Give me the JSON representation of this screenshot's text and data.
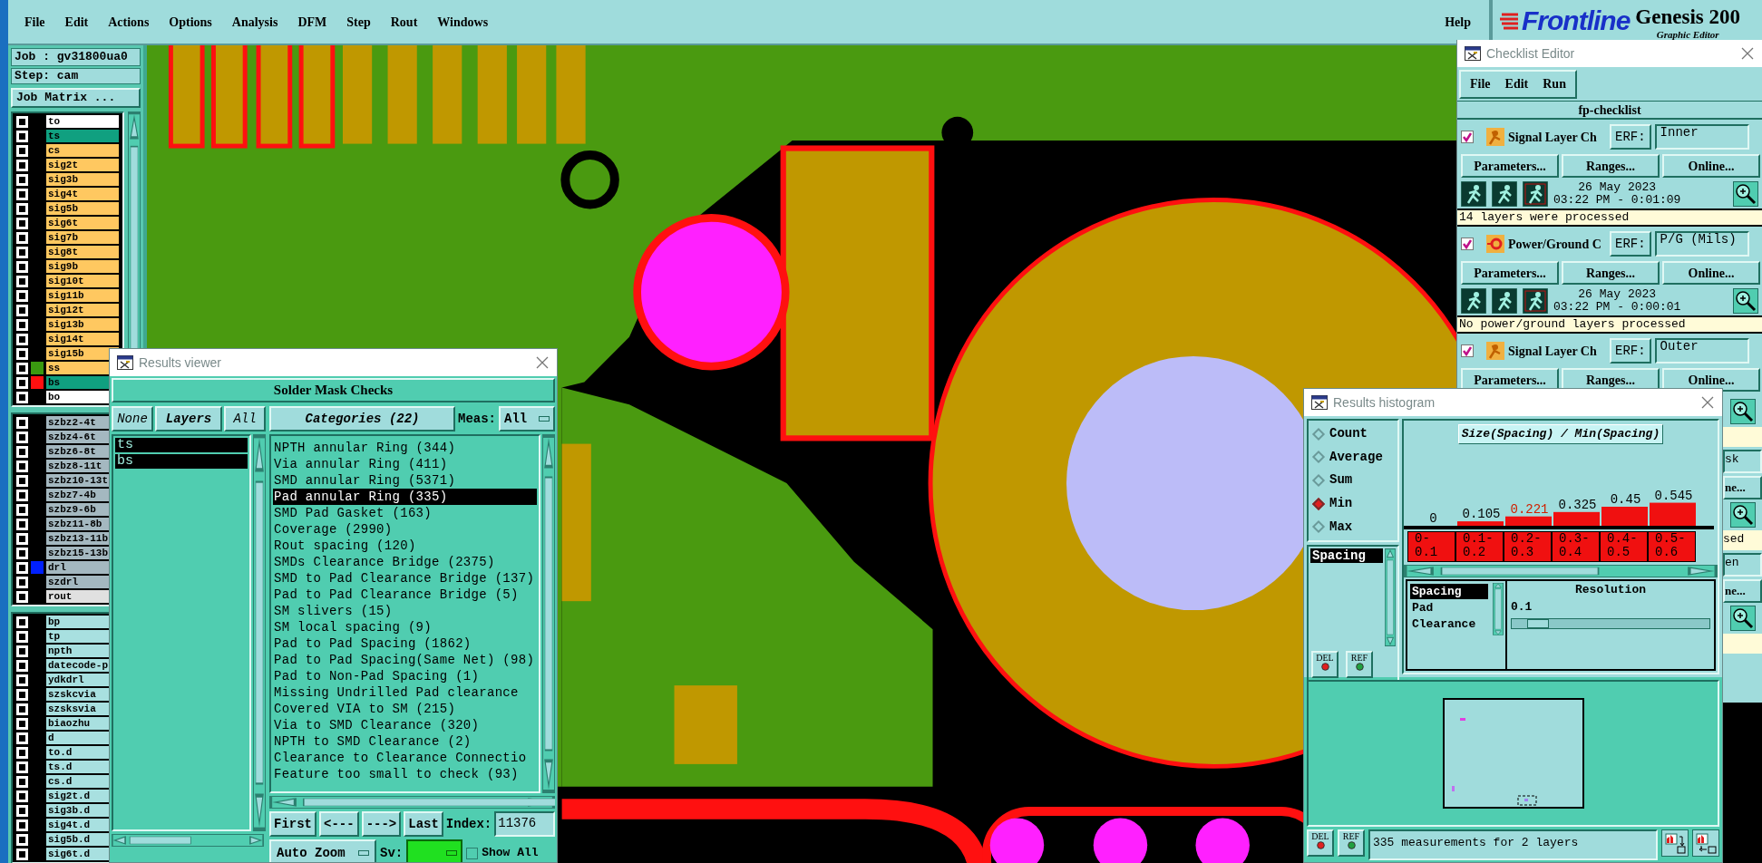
{
  "menu_bar": {
    "items": [
      "File",
      "Edit",
      "Actions",
      "Options",
      "Analysis",
      "DFM",
      "Step",
      "Rout",
      "Windows"
    ],
    "help": "Help"
  },
  "logo": {
    "brand": "Frontline",
    "product": "Genesis 200",
    "subtitle": "Graphic Editor"
  },
  "job_panel": {
    "job": "Job : gv31800ua0",
    "step": "Step: cam",
    "matrix_button": "Job Matrix ...",
    "layer_groups": [
      [
        {
          "name": "to",
          "color": "#ffffff",
          "checked": false
        },
        {
          "name": "ts",
          "color": "#10a080",
          "checked": false
        },
        {
          "name": "cs",
          "color": "#ffc860",
          "checked": false
        },
        {
          "name": "sig2t",
          "color": "#ffc860",
          "checked": false
        },
        {
          "name": "sig3b",
          "color": "#ffc860",
          "checked": false
        },
        {
          "name": "sig4t",
          "color": "#ffc860",
          "checked": false
        },
        {
          "name": "sig5b",
          "color": "#ffc860",
          "checked": false
        },
        {
          "name": "sig6t",
          "color": "#ffc860",
          "checked": false
        },
        {
          "name": "sig7b",
          "color": "#ffc860",
          "checked": false
        },
        {
          "name": "sig8t",
          "color": "#ffc860",
          "checked": false
        },
        {
          "name": "sig9b",
          "color": "#ffc860",
          "checked": false
        },
        {
          "name": "sig10t",
          "color": "#ffc860",
          "checked": false
        },
        {
          "name": "sig11b",
          "color": "#ffc860",
          "checked": false
        },
        {
          "name": "sig12t",
          "color": "#ffc860",
          "checked": false
        },
        {
          "name": "sig13b",
          "color": "#ffc860",
          "checked": false
        },
        {
          "name": "sig14t",
          "color": "#ffc860",
          "checked": false
        },
        {
          "name": "sig15b",
          "color": "#ffc860",
          "checked": false
        },
        {
          "name": "ss",
          "color": "#ffc860",
          "checked": false,
          "swatch": {
            "color": "#3a9a10"
          }
        },
        {
          "name": "bs",
          "color": "#10a080",
          "checked": false,
          "swatch": {
            "color": "#ff1010"
          }
        },
        {
          "name": "bo",
          "color": "#ffffff",
          "checked": false
        }
      ],
      [
        {
          "name": "szbz2-4t",
          "color": "#a4b8c0",
          "checked": false
        },
        {
          "name": "szbz4-6t",
          "color": "#a4b8c0",
          "checked": false
        },
        {
          "name": "szbz6-8t",
          "color": "#a4b8c0",
          "checked": false
        },
        {
          "name": "szbz8-11t",
          "color": "#a4b8c0",
          "checked": false
        },
        {
          "name": "szbz10-13t",
          "color": "#a4b8c0",
          "checked": false
        },
        {
          "name": "szbz7-4b",
          "color": "#a4b8c0",
          "checked": false
        },
        {
          "name": "szbz9-6b",
          "color": "#a4b8c0",
          "checked": false
        },
        {
          "name": "szbz11-8b",
          "color": "#a4b8c0",
          "checked": false
        },
        {
          "name": "szbz13-11b",
          "color": "#a4b8c0",
          "checked": false
        },
        {
          "name": "szbz15-13b",
          "color": "#a4b8c0",
          "checked": false
        },
        {
          "name": "drl",
          "color": "#a4b8c0",
          "checked": false,
          "swatch": {
            "color": "#0020ff"
          }
        },
        {
          "name": "szdrl",
          "color": "#a4b8c0",
          "checked": false
        },
        {
          "name": "rout",
          "color": "#e0e0e0",
          "checked": false
        }
      ],
      [
        {
          "name": "bp",
          "color": "#a8e0e0",
          "checked": false
        },
        {
          "name": "tp",
          "color": "#a8e0e0",
          "checked": false
        },
        {
          "name": "npth",
          "color": "#a8e0e0",
          "checked": false
        },
        {
          "name": "datecode-p",
          "color": "#a8e0e0",
          "checked": false
        },
        {
          "name": "ydkdrl",
          "color": "#a8e0e0",
          "checked": false
        },
        {
          "name": "szskcvia",
          "color": "#a8e0e0",
          "checked": false
        },
        {
          "name": "szsksvia",
          "color": "#a8e0e0",
          "checked": false
        },
        {
          "name": "biaozhu",
          "color": "#a8e0e0",
          "checked": false
        },
        {
          "name": "d",
          "color": "#a8e0e0",
          "checked": false
        },
        {
          "name": "to.d",
          "color": "#a8e0e0",
          "checked": false
        },
        {
          "name": "ts.d",
          "color": "#a8e0e0",
          "checked": false
        },
        {
          "name": "cs.d",
          "color": "#a8e0e0",
          "checked": false
        },
        {
          "name": "sig2t.d",
          "color": "#a8e0e0",
          "checked": false
        },
        {
          "name": "sig3b.d",
          "color": "#a8e0e0",
          "checked": false
        },
        {
          "name": "sig4t.d",
          "color": "#a8e0e0",
          "checked": false
        },
        {
          "name": "sig5b.d",
          "color": "#a8e0e0",
          "checked": false
        },
        {
          "name": "sig6t.d",
          "color": "#a8e0e0",
          "checked": false
        }
      ]
    ]
  },
  "results_viewer": {
    "title": "Results viewer",
    "header": "Solder Mask Checks",
    "layer_buttons": [
      "None",
      "Layers",
      "All"
    ],
    "layers": [
      {
        "label": "ts",
        "selected": true
      },
      {
        "label": "bs",
        "selected": true
      }
    ],
    "categories_button": "Categories (22)",
    "meas_label": "Meas:",
    "meas_value": "All",
    "categories": [
      {
        "label": "NPTH annular Ring (344)",
        "selected": false
      },
      {
        "label": "Via annular Ring (411)",
        "selected": false
      },
      {
        "label": "SMD annular Ring (5371)",
        "selected": false
      },
      {
        "label": "Pad annular Ring (335)",
        "selected": true
      },
      {
        "label": "SMD Pad Gasket (163)",
        "selected": false
      },
      {
        "label": "Coverage (2990)",
        "selected": false
      },
      {
        "label": "Rout spacing (120)",
        "selected": false
      },
      {
        "label": "SMDs Clearance Bridge (2375)",
        "selected": false
      },
      {
        "label": "SMD to Pad Clearance Bridge (137)",
        "selected": false
      },
      {
        "label": "Pad to Pad Clearance Bridge (5)",
        "selected": false
      },
      {
        "label": "SM slivers (15)",
        "selected": false
      },
      {
        "label": "SM local spacing (9)",
        "selected": false
      },
      {
        "label": "Pad to Pad Spacing (1862)",
        "selected": false
      },
      {
        "label": "Pad to Pad Spacing(Same Net) (98)",
        "selected": false
      },
      {
        "label": "Pad to Non-Pad Spacing (1)",
        "selected": false
      },
      {
        "label": "Missing Undrilled Pad clearance",
        "selected": false
      },
      {
        "label": "Covered VIA to SM (215)",
        "selected": false
      },
      {
        "label": "Via to SMD Clearance (320)",
        "selected": false
      },
      {
        "label": "NPTH to SMD Clearance (2)",
        "selected": false
      },
      {
        "label": "Clearance to Clearance Connectio",
        "selected": false
      },
      {
        "label": "Feature too small to check (93)",
        "selected": false
      }
    ],
    "nav_buttons": [
      "First",
      "<---",
      "--->",
      "Last"
    ],
    "index_label": "Index:",
    "index_value": "11376",
    "zoom_mode": "Auto Zoom",
    "sv_label": "Sv:",
    "show_all": {
      "label": "Show All",
      "checked": false
    }
  },
  "checklist_editor": {
    "title": "Checklist Editor",
    "menu": [
      "File",
      "Edit",
      "Run"
    ],
    "name": "fp-checklist",
    "checks": [
      {
        "kind": "signal",
        "enabled": true,
        "label": "Signal Layer Ch",
        "erf_label": "ERF:",
        "erf_value": "Inner",
        "buttons": [
          "Parameters...",
          "Ranges...",
          "Online..."
        ],
        "date": "26 May 2023",
        "time": "03:22 PM - 0:01:09",
        "message": "14 layers were processed"
      },
      {
        "kind": "power",
        "enabled": true,
        "label": "Power/Ground C",
        "erf_label": "ERF:",
        "erf_value": "P/G (Mils)",
        "buttons": [
          "Parameters...",
          "Ranges...",
          "Online..."
        ],
        "date": "26 May 2023",
        "time": "03:22 PM - 0:00:01",
        "message": "No power/ground layers processed"
      },
      {
        "kind": "signal",
        "enabled": true,
        "label": "Signal Layer Ch",
        "erf_label": "ERF:",
        "erf_value": "Outer",
        "buttons": [
          "Parameters...",
          "Ranges...",
          "Online..."
        ]
      }
    ],
    "covered_fragments": [
      {
        "kind": "zoom"
      },
      {
        "kind": "message"
      },
      {
        "kind": "field",
        "text": "sk"
      },
      {
        "kind": "button",
        "text": "ne..."
      },
      {
        "kind": "zoom"
      },
      {
        "kind": "message",
        "text": "sed"
      },
      {
        "kind": "field",
        "text": "en"
      },
      {
        "kind": "button",
        "text": "ne..."
      },
      {
        "kind": "zoom"
      },
      {
        "kind": "message"
      }
    ]
  },
  "results_histogram": {
    "title": "Results histogram",
    "functions": [
      {
        "label": "Count",
        "selected": false
      },
      {
        "label": "Average",
        "selected": false
      },
      {
        "label": "Sum",
        "selected": false
      },
      {
        "label": "Min",
        "selected": true
      },
      {
        "label": "Max",
        "selected": false
      }
    ],
    "measures": [
      {
        "label": "Spacing",
        "selected": true
      }
    ],
    "list_buttons": [
      "DEL",
      "REF"
    ],
    "chart_data": {
      "type": "bar",
      "title": "Size(Spacing) / Min(Spacing)",
      "categories": [
        "0-0.1",
        "0.1-0.2",
        "0.2-0.3",
        "0.3-0.4",
        "0.4-0.5",
        "0.5-0.6"
      ],
      "values": [
        0,
        0.105,
        0.221,
        0.325,
        0.45,
        0.545
      ],
      "data_labels": true
    },
    "bin_states": [
      {
        "selected": false
      },
      {
        "selected": false
      },
      {
        "selected": true
      },
      {
        "selected": false
      },
      {
        "selected": false
      },
      {
        "selected": false
      }
    ],
    "fields": [
      {
        "label": "Spacing",
        "selected": true
      },
      {
        "label": "Pad",
        "selected": false
      },
      {
        "label": "Clearance",
        "selected": false
      }
    ],
    "resolution_label": "Resolution",
    "resolution_value": "0.1",
    "resolution_slider": {
      "level": 0.08
    },
    "status_buttons": [
      "DEL",
      "REF"
    ],
    "status": "335 measurements for 2 layers"
  }
}
